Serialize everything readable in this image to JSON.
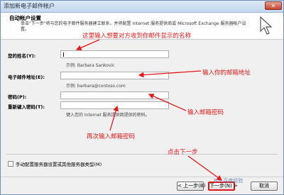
{
  "window": {
    "title": "添加新电子邮件帐户",
    "close_label": "✕"
  },
  "header": {
    "title": "自动帐户设置",
    "description": "单击\"下一步\"将与您的电子邮件服务器建立联系，并将配置 Internet 服务提供商或 Microsoft Exchange 服务器帐户设置。"
  },
  "form": {
    "name": {
      "label": "您的姓名(Y):",
      "value": "",
      "example": "示例: Barbara Sankovic"
    },
    "email": {
      "label": "电子邮件地址(E):",
      "value": "",
      "example": "示例: barbara@contoso.com"
    },
    "password": {
      "label": "密码(P):",
      "value": ""
    },
    "retype": {
      "label": "重新键入密码(T):",
      "value": "",
      "hint": "键入您的 Internet 服务提供商提供的密码。"
    }
  },
  "manual_config": {
    "label": "手动配置服务器设置或其他服务器类型(M)",
    "checked": false
  },
  "annotations": {
    "name": "这里输入想要对方收到你邮件显示的名称",
    "email": "输入你的邮箱地址",
    "password": "输入邮箱密码",
    "retype": "再次输入邮箱密码",
    "next": "点击下一步"
  },
  "buttons": {
    "back": "< 上一步(B)",
    "next": "下一步(N) >",
    "cancel": "取消"
  },
  "watermark": "Bai 百度经验",
  "colors": {
    "annotation": "#e21818",
    "header_bg": "#ffffff",
    "window_bg": "#f0f0f0"
  }
}
